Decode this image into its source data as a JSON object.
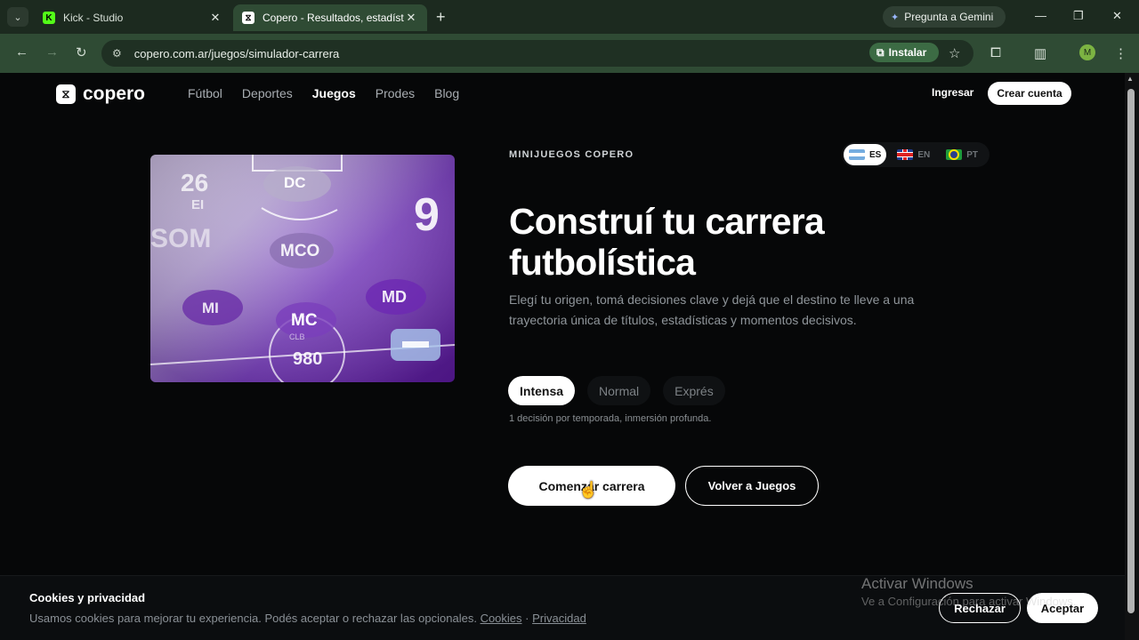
{
  "browser": {
    "tabs": [
      {
        "title": "Kick - Studio",
        "favicon": "kick-icon"
      },
      {
        "title": "Copero - Resultados, estadístic",
        "favicon": "copero-icon",
        "active": true
      }
    ],
    "gemini_label": "Pregunta a Gemini",
    "url": "copero.com.ar/juegos/simulador-carrera",
    "install_label": "Instalar",
    "avatar_initial": "M"
  },
  "site": {
    "brand": "copero",
    "nav": [
      "Fútbol",
      "Deportes",
      "Juegos",
      "Prodes",
      "Blog"
    ],
    "active_nav": "Juegos",
    "login": "Ingresar",
    "signup": "Crear cuenta"
  },
  "hero": {
    "image_labels": [
      "DC",
      "MCO",
      "MI",
      "MC",
      "MD",
      "9",
      "26",
      "EI",
      "SOM",
      "980",
      "CLB"
    ],
    "eyebrow": "MINIJUEGOS COPERO",
    "languages": [
      {
        "code": "ES",
        "flag": "argentina-flag",
        "active": true
      },
      {
        "code": "EN",
        "flag": "uk-flag"
      },
      {
        "code": "PT",
        "flag": "brazil-flag"
      }
    ],
    "headline_line1": "Construí tu carrera",
    "headline_line2": "futbolística",
    "description": "Elegí tu origen, tomá decisiones clave y dejá que el destino te lleve a una trayectoria única de títulos, estadísticas y momentos decisivos.",
    "modes": [
      "Intensa",
      "Normal",
      "Exprés"
    ],
    "active_mode": "Intensa",
    "mode_hint": "1 decisión por temporada, inmersión profunda.",
    "start_button": "Comenzar carrera",
    "back_button": "Volver a Juegos"
  },
  "cookies": {
    "title": "Cookies y privacidad",
    "text": "Usamos cookies para mejorar tu experiencia. Podés aceptar o rechazar las opcionales.",
    "link_cookies": "Cookies",
    "separator": "·",
    "link_privacy": "Privacidad",
    "reject": "Rechazar",
    "accept": "Aceptar"
  },
  "watermark": {
    "title": "Activar Windows",
    "subtitle": "Ve a Configuración para activar Windows."
  },
  "colors": {
    "browser_frame": "#2f4b34",
    "page_bg": "#060708",
    "accent": "#ffffff",
    "hero_purple": "#7a3fc0"
  }
}
